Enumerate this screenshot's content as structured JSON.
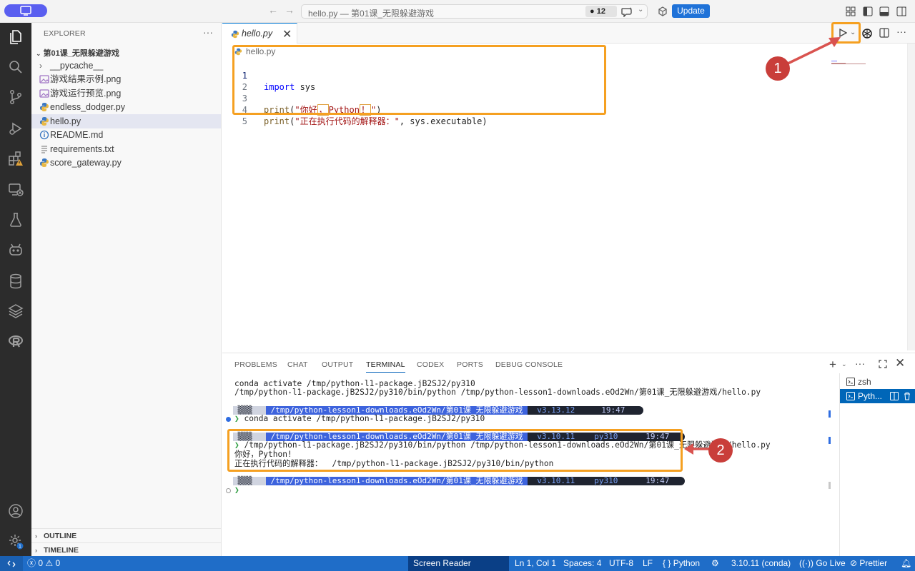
{
  "titlebar": {
    "search_text": "hello.py — 第01课_无限躲避游戏",
    "badge_count": "12",
    "update_label": "Update"
  },
  "sidebar": {
    "title": "EXPLORER",
    "more": "···",
    "folder": "第01课_无限躲避游戏",
    "items": [
      {
        "label": "__pycache__",
        "icon": "chevron-right-icon"
      },
      {
        "label": "游戏结果示例.png",
        "icon": "image-icon"
      },
      {
        "label": "游戏运行预览.png",
        "icon": "image-icon"
      },
      {
        "label": "endless_dodger.py",
        "icon": "python-icon"
      },
      {
        "label": "hello.py",
        "icon": "python-icon"
      },
      {
        "label": "README.md",
        "icon": "info-icon"
      },
      {
        "label": "requirements.txt",
        "icon": "text-file-icon"
      },
      {
        "label": "score_gateway.py",
        "icon": "python-icon"
      }
    ],
    "outline": "OUTLINE",
    "timeline": "TIMELINE"
  },
  "editor": {
    "tab_label": "hello.py",
    "breadcrumb": "hello.py",
    "line_numbers": [
      "1",
      "2",
      "3",
      "4",
      "5"
    ],
    "lines": {
      "l1_kw": "import",
      "l1_rest": " sys",
      "l3_fn": "print",
      "l3_open": "(",
      "l3_str_a": "\"你好",
      "l3_str_b": "，",
      "l3_str_c": "Python",
      "l3_str_d": "！",
      "l3_str_e": "\"",
      "l3_close": ")",
      "l4_fn": "print",
      "l4_open": "(",
      "l4_str": "\"正在执行代码的解释器：\"",
      "l4_rest": ", sys.executable)"
    }
  },
  "panel": {
    "tabs": [
      "PROBLEMS",
      "CHAT",
      "OUTPUT",
      "TERMINAL",
      "CODEX",
      "PORTS",
      "DEBUG CONSOLE"
    ],
    "active_tab": "TERMINAL",
    "terminal": {
      "line1": "conda activate /tmp/python-l1-package.jB2SJ2/py310",
      "line2": "/tmp/python-l1-package.jB2SJ2/py310/bin/python /tmp/python-lesson1-downloads.eOd2Wn/第01课_无限躲避游戏/hello.py",
      "prompt_path": " /tmp/python-lesson1-downloads.eOd2Wn/第01课_无限躲避游戏 ",
      "prompt1_ver": "  v3.13.12 ",
      "prompt1_time": "  19:47 ",
      "cmd1": "conda activate /tmp/python-l1-package.jB2SJ2/py310",
      "prompt2_ver": "  v3.10.11 ",
      "prompt2_env": "  py310 ",
      "prompt2_time": "  19:47 ",
      "cmd2": "/tmp/python-l1-package.jB2SJ2/py310/bin/python /tmp/python-lesson1-downloads.eOd2Wn/第01课_无限躲避游戏/hello.py",
      "out1": "你好，Python!",
      "out2": "正在执行代码的解释器：  /tmp/python-l1-package.jB2SJ2/py310/bin/python",
      "prompt3_ver": "  v3.10.11 ",
      "prompt3_env": "  py310 ",
      "prompt3_time": "  19:47 ",
      "prompt_glyph": "❯"
    },
    "terminals": [
      {
        "label": "zsh"
      },
      {
        "label": "Pyth..."
      }
    ]
  },
  "statusbar": {
    "errors": "0",
    "warnings": "0",
    "screen_reader": "Screen Reader Optimized",
    "position": "Ln 1, Col 1",
    "spaces": "Spaces: 4",
    "encoding": "UTF-8",
    "eol": "LF",
    "language": "Python",
    "interpreter": "3.10.11 (conda)",
    "golive": "Go Live",
    "prettier": "Prettier",
    "braces": "{ }"
  },
  "annotations": {
    "marker1": "1",
    "marker2": "2"
  },
  "colors": {
    "accent": "#0078d4",
    "status_bar": "#1f6dc8",
    "annotation_box": "#f5a021",
    "annotation_marker": "#c93e3a",
    "prompt_blue": "#3d63dd",
    "prompt_dark": "#1f2430"
  }
}
